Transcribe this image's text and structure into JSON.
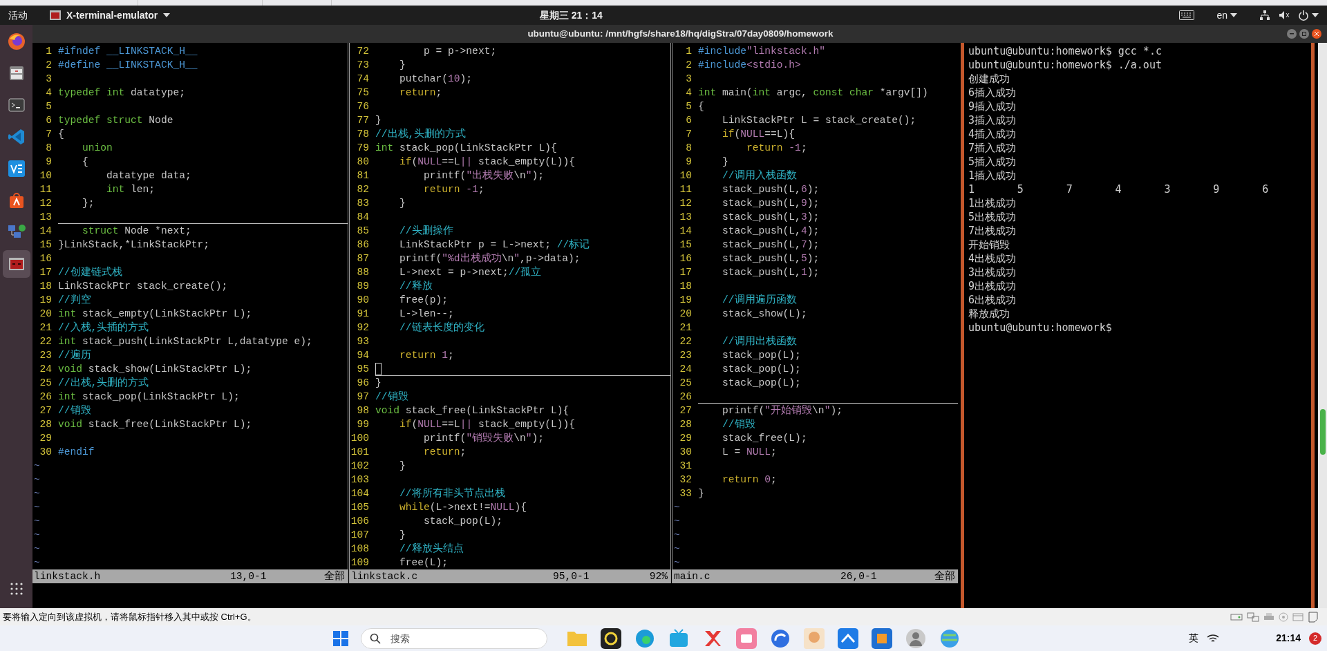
{
  "top_bar": {
    "activities": "活动",
    "app_menu": "X-terminal-emulator",
    "clock": "星期三 21：14",
    "language": "en"
  },
  "window": {
    "title": "ubuntu@ubuntu: /mnt/hgfs/share18/hq/digStra/07day0809/homework"
  },
  "dock": {
    "items": [
      {
        "kind": "browser",
        "active": false
      },
      {
        "kind": "files",
        "active": false
      },
      {
        "kind": "terminal",
        "active": false
      },
      {
        "kind": "code",
        "active": false
      },
      {
        "kind": "vm",
        "active": false
      },
      {
        "kind": "store",
        "active": false
      },
      {
        "kind": "network",
        "active": false
      },
      {
        "kind": "xterm",
        "active": true
      },
      {
        "kind": "apps",
        "active": false
      }
    ]
  },
  "editor_panes": [
    {
      "active": false,
      "lines": [
        {
          "n": "1",
          "current": false,
          "spans": [
            {
              "kind": "pre",
              "text": "#ifndef __LINKSTACK_H__"
            }
          ]
        },
        {
          "n": "2",
          "current": false,
          "spans": [
            {
              "kind": "pre",
              "text": "#define __LINKSTACK_H__"
            }
          ]
        },
        {
          "n": "3",
          "current": false
        },
        {
          "n": "4",
          "current": false,
          "spans": [
            {
              "kind": "type",
              "text": "typedef int"
            },
            {
              "kind": "plain",
              "text": " datatype;"
            }
          ]
        },
        {
          "n": "5",
          "current": false
        },
        {
          "n": "6",
          "current": false,
          "spans": [
            {
              "kind": "type",
              "text": "typedef struct"
            },
            {
              "kind": "plain",
              "text": " Node"
            }
          ]
        },
        {
          "n": "7",
          "current": false,
          "spans": [
            {
              "kind": "plain",
              "text": "{"
            }
          ]
        },
        {
          "n": "8",
          "current": false,
          "spans": [
            {
              "kind": "type",
              "text": "    union"
            }
          ]
        },
        {
          "n": "9",
          "current": false,
          "spans": [
            {
              "kind": "plain",
              "text": "    {"
            }
          ]
        },
        {
          "n": "10",
          "current": false,
          "spans": [
            {
              "kind": "plain",
              "text": "        datatype data;"
            }
          ]
        },
        {
          "n": "11",
          "current": false,
          "spans": [
            {
              "kind": "type",
              "text": "        int"
            },
            {
              "kind": "plain",
              "text": " len;"
            }
          ]
        },
        {
          "n": "12",
          "current": false,
          "spans": [
            {
              "kind": "plain",
              "text": "    };"
            }
          ]
        },
        {
          "n": "13",
          "current": true
        },
        {
          "n": "14",
          "current": false,
          "spans": [
            {
              "kind": "type",
              "text": "    struct"
            },
            {
              "kind": "plain",
              "text": " Node *next;"
            }
          ]
        },
        {
          "n": "15",
          "current": false,
          "spans": [
            {
              "kind": "plain",
              "text": "}LinkStack,*LinkStackPtr;"
            }
          ]
        },
        {
          "n": "16",
          "current": false
        },
        {
          "n": "17",
          "current": false,
          "spans": [
            {
              "kind": "cm",
              "text": "//创建链式栈"
            }
          ]
        },
        {
          "n": "18",
          "current": false,
          "spans": [
            {
              "kind": "plain",
              "text": "LinkStackPtr stack_create();"
            }
          ]
        },
        {
          "n": "19",
          "current": false,
          "spans": [
            {
              "kind": "cm",
              "text": "//判空"
            }
          ]
        },
        {
          "n": "20",
          "current": false,
          "spans": [
            {
              "kind": "type",
              "text": "int"
            },
            {
              "kind": "plain",
              "text": " stack_empty(LinkStackPtr L);"
            }
          ]
        },
        {
          "n": "21",
          "current": false,
          "spans": [
            {
              "kind": "cm",
              "text": "//入栈,头插的方式"
            }
          ]
        },
        {
          "n": "22",
          "current": false,
          "spans": [
            {
              "kind": "type",
              "text": "int"
            },
            {
              "kind": "plain",
              "text": " stack_push(LinkStackPtr L,datatype e);"
            }
          ]
        },
        {
          "n": "23",
          "current": false,
          "spans": [
            {
              "kind": "cm",
              "text": "//遍历"
            }
          ]
        },
        {
          "n": "24",
          "current": false,
          "spans": [
            {
              "kind": "type",
              "text": "void"
            },
            {
              "kind": "plain",
              "text": " stack_show(LinkStackPtr L);"
            }
          ]
        },
        {
          "n": "25",
          "current": false,
          "spans": [
            {
              "kind": "cm",
              "text": "//出栈,头删的方式"
            }
          ]
        },
        {
          "n": "26",
          "current": false,
          "spans": [
            {
              "kind": "type",
              "text": "int"
            },
            {
              "kind": "plain",
              "text": " stack_pop(LinkStackPtr L);"
            }
          ]
        },
        {
          "n": "27",
          "current": false,
          "spans": [
            {
              "kind": "cm",
              "text": "//销毁"
            }
          ]
        },
        {
          "n": "28",
          "current": false,
          "spans": [
            {
              "kind": "type",
              "text": "void"
            },
            {
              "kind": "plain",
              "text": " stack_free(LinkStackPtr L);"
            }
          ]
        },
        {
          "n": "29",
          "current": false
        },
        {
          "n": "30",
          "current": false,
          "spans": [
            {
              "kind": "pre",
              "text": "#endif"
            }
          ]
        }
      ],
      "filler": [
        "~",
        "~",
        "~",
        "~",
        "~",
        "~",
        "~",
        "~"
      ],
      "status": {
        "file": "linkstack.h",
        "position": "13,0-1",
        "scroll": "全部"
      }
    },
    {
      "active": true,
      "lines": [
        {
          "n": "72",
          "current": false,
          "spans": [
            {
              "kind": "plain",
              "text": "        p = p->next;"
            }
          ]
        },
        {
          "n": "73",
          "current": false,
          "spans": [
            {
              "kind": "plain",
              "text": "    }"
            }
          ]
        },
        {
          "n": "74",
          "current": false,
          "spans": [
            {
              "kind": "plain",
              "text": "    putchar("
            },
            {
              "kind": "num",
              "text": "10"
            },
            {
              "kind": "plain",
              "text": ");"
            }
          ]
        },
        {
          "n": "75",
          "current": false,
          "spans": [
            {
              "kind": "kw",
              "text": "    return"
            },
            {
              "kind": "plain",
              "text": ";"
            }
          ]
        },
        {
          "n": "76",
          "current": false
        },
        {
          "n": "77",
          "current": false,
          "spans": [
            {
              "kind": "plain",
              "text": "}"
            }
          ]
        },
        {
          "n": "78",
          "current": false,
          "spans": [
            {
              "kind": "cm",
              "text": "//出栈,头删的方式"
            }
          ]
        },
        {
          "n": "79",
          "current": false,
          "spans": [
            {
              "kind": "type",
              "text": "int"
            },
            {
              "kind": "plain",
              "text": " stack_pop(LinkStackPtr L){"
            }
          ]
        },
        {
          "n": "80",
          "current": false,
          "spans": [
            {
              "kind": "kw",
              "text": "    if"
            },
            {
              "kind": "plain",
              "text": "("
            },
            {
              "kind": "num",
              "text": "NULL"
            },
            {
              "kind": "plain",
              "text": "==L"
            },
            {
              "kind": "num",
              "text": "||"
            },
            {
              "kind": "plain",
              "text": " stack_empty(L)){"
            }
          ]
        },
        {
          "n": "81",
          "current": false,
          "spans": [
            {
              "kind": "plain",
              "text": "        printf("
            },
            {
              "kind": "str",
              "text": "\"出栈失败"
            },
            {
              "kind": "plain",
              "text": "\\n"
            },
            {
              "kind": "str",
              "text": "\""
            },
            {
              "kind": "plain",
              "text": ");"
            }
          ]
        },
        {
          "n": "82",
          "current": false,
          "spans": [
            {
              "kind": "kw",
              "text": "        return"
            },
            {
              "kind": "num",
              "text": " -1"
            },
            {
              "kind": "plain",
              "text": ";"
            }
          ]
        },
        {
          "n": "83",
          "current": false,
          "spans": [
            {
              "kind": "plain",
              "text": "    }"
            }
          ]
        },
        {
          "n": "84",
          "current": false
        },
        {
          "n": "85",
          "current": false,
          "spans": [
            {
              "kind": "cm",
              "text": "    //头删操作"
            }
          ]
        },
        {
          "n": "86",
          "current": false,
          "spans": [
            {
              "kind": "plain",
              "text": "    LinkStackPtr p = L->next; "
            },
            {
              "kind": "cm",
              "text": "//标记"
            }
          ]
        },
        {
          "n": "87",
          "current": false,
          "spans": [
            {
              "kind": "plain",
              "text": "    printf("
            },
            {
              "kind": "str",
              "text": "\"%d出栈成功"
            },
            {
              "kind": "plain",
              "text": "\\n"
            },
            {
              "kind": "str",
              "text": "\""
            },
            {
              "kind": "plain",
              "text": ",p->data);"
            }
          ]
        },
        {
          "n": "88",
          "current": false,
          "spans": [
            {
              "kind": "plain",
              "text": "    L->next = p->next;"
            },
            {
              "kind": "cm",
              "text": "//孤立"
            }
          ]
        },
        {
          "n": "89",
          "current": false,
          "spans": [
            {
              "kind": "cm",
              "text": "    //释放"
            }
          ]
        },
        {
          "n": "90",
          "current": false,
          "spans": [
            {
              "kind": "plain",
              "text": "    free(p);"
            }
          ]
        },
        {
          "n": "91",
          "current": false,
          "spans": [
            {
              "kind": "plain",
              "text": "    L->len--;"
            }
          ]
        },
        {
          "n": "92",
          "current": false,
          "spans": [
            {
              "kind": "cm",
              "text": "    //链表长度的变化"
            }
          ]
        },
        {
          "n": "93",
          "current": false
        },
        {
          "n": "94",
          "current": false,
          "spans": [
            {
              "kind": "kw",
              "text": "    return"
            },
            {
              "kind": "num",
              "text": " 1"
            },
            {
              "kind": "plain",
              "text": ";"
            }
          ]
        },
        {
          "n": "95",
          "current": true
        },
        {
          "n": "96",
          "current": false,
          "spans": [
            {
              "kind": "plain",
              "text": "}"
            }
          ]
        },
        {
          "n": "97",
          "current": false,
          "spans": [
            {
              "kind": "cm",
              "text": "//销毁"
            }
          ]
        },
        {
          "n": "98",
          "current": false,
          "spans": [
            {
              "kind": "type",
              "text": "void"
            },
            {
              "kind": "plain",
              "text": " stack_free(LinkStackPtr L){"
            }
          ]
        },
        {
          "n": "99",
          "current": false,
          "spans": [
            {
              "kind": "kw",
              "text": "    if"
            },
            {
              "kind": "plain",
              "text": "("
            },
            {
              "kind": "num",
              "text": "NULL"
            },
            {
              "kind": "plain",
              "text": "==L"
            },
            {
              "kind": "num",
              "text": "||"
            },
            {
              "kind": "plain",
              "text": " stack_empty(L)){"
            }
          ]
        },
        {
          "n": "100",
          "current": false,
          "spans": [
            {
              "kind": "plain",
              "text": "        printf("
            },
            {
              "kind": "str",
              "text": "\"销毁失败"
            },
            {
              "kind": "plain",
              "text": "\\n"
            },
            {
              "kind": "str",
              "text": "\""
            },
            {
              "kind": "plain",
              "text": ");"
            }
          ]
        },
        {
          "n": "101",
          "current": false,
          "spans": [
            {
              "kind": "kw",
              "text": "        return"
            },
            {
              "kind": "plain",
              "text": ";"
            }
          ]
        },
        {
          "n": "102",
          "current": false,
          "spans": [
            {
              "kind": "plain",
              "text": "    }"
            }
          ]
        },
        {
          "n": "103",
          "current": false
        },
        {
          "n": "104",
          "current": false,
          "spans": [
            {
              "kind": "cm",
              "text": "    //将所有非头节点出栈"
            }
          ]
        },
        {
          "n": "105",
          "current": false,
          "spans": [
            {
              "kind": "kw",
              "text": "    while"
            },
            {
              "kind": "plain",
              "text": "(L->next!="
            },
            {
              "kind": "num",
              "text": "NULL"
            },
            {
              "kind": "plain",
              "text": "){"
            }
          ]
        },
        {
          "n": "106",
          "current": false,
          "spans": [
            {
              "kind": "plain",
              "text": "        stack_pop(L);"
            }
          ]
        },
        {
          "n": "107",
          "current": false,
          "spans": [
            {
              "kind": "plain",
              "text": "    }"
            }
          ]
        },
        {
          "n": "108",
          "current": false,
          "spans": [
            {
              "kind": "cm",
              "text": "    //释放头结点"
            }
          ]
        },
        {
          "n": "109",
          "current": false,
          "spans": [
            {
              "kind": "plain",
              "text": "    free(L);"
            }
          ]
        }
      ],
      "status": {
        "file": "linkstack.c",
        "position": "95,0-1",
        "scroll": "92%"
      }
    },
    {
      "active": false,
      "lines": [
        {
          "n": "1",
          "current": false,
          "spans": [
            {
              "kind": "pre",
              "text": "#include"
            },
            {
              "kind": "str",
              "text": "\"linkstack.h\""
            }
          ]
        },
        {
          "n": "2",
          "current": false,
          "spans": [
            {
              "kind": "pre",
              "text": "#include"
            },
            {
              "kind": "str",
              "text": "<stdio.h>"
            }
          ]
        },
        {
          "n": "3",
          "current": false
        },
        {
          "n": "4",
          "current": false,
          "spans": [
            {
              "kind": "type",
              "text": "int"
            },
            {
              "kind": "plain",
              "text": " main("
            },
            {
              "kind": "type",
              "text": "int"
            },
            {
              "kind": "plain",
              "text": " argc, "
            },
            {
              "kind": "type",
              "text": "const char"
            },
            {
              "kind": "plain",
              "text": " *argv[])"
            }
          ]
        },
        {
          "n": "5",
          "current": false,
          "spans": [
            {
              "kind": "plain",
              "text": "{"
            }
          ]
        },
        {
          "n": "6",
          "current": false,
          "spans": [
            {
              "kind": "plain",
              "text": "    LinkStackPtr L = stack_create();"
            }
          ]
        },
        {
          "n": "7",
          "current": false,
          "spans": [
            {
              "kind": "kw",
              "text": "    if"
            },
            {
              "kind": "plain",
              "text": "("
            },
            {
              "kind": "num",
              "text": "NULL"
            },
            {
              "kind": "plain",
              "text": "==L){"
            }
          ]
        },
        {
          "n": "8",
          "current": false,
          "spans": [
            {
              "kind": "kw",
              "text": "        return"
            },
            {
              "kind": "num",
              "text": " -1"
            },
            {
              "kind": "plain",
              "text": ";"
            }
          ]
        },
        {
          "n": "9",
          "current": false,
          "spans": [
            {
              "kind": "plain",
              "text": "    }"
            }
          ]
        },
        {
          "n": "10",
          "current": false,
          "spans": [
            {
              "kind": "cm",
              "text": "    //调用入栈函数"
            }
          ]
        },
        {
          "n": "11",
          "current": false,
          "spans": [
            {
              "kind": "plain",
              "text": "    stack_push(L,"
            },
            {
              "kind": "num",
              "text": "6"
            },
            {
              "kind": "plain",
              "text": ");"
            }
          ]
        },
        {
          "n": "12",
          "current": false,
          "spans": [
            {
              "kind": "plain",
              "text": "    stack_push(L,"
            },
            {
              "kind": "num",
              "text": "9"
            },
            {
              "kind": "plain",
              "text": ");"
            }
          ]
        },
        {
          "n": "13",
          "current": false,
          "spans": [
            {
              "kind": "plain",
              "text": "    stack_push(L,"
            },
            {
              "kind": "num",
              "text": "3"
            },
            {
              "kind": "plain",
              "text": ");"
            }
          ]
        },
        {
          "n": "14",
          "current": false,
          "spans": [
            {
              "kind": "plain",
              "text": "    stack_push(L,"
            },
            {
              "kind": "num",
              "text": "4"
            },
            {
              "kind": "plain",
              "text": ");"
            }
          ]
        },
        {
          "n": "15",
          "current": false,
          "spans": [
            {
              "kind": "plain",
              "text": "    stack_push(L,"
            },
            {
              "kind": "num",
              "text": "7"
            },
            {
              "kind": "plain",
              "text": ");"
            }
          ]
        },
        {
          "n": "16",
          "current": false,
          "spans": [
            {
              "kind": "plain",
              "text": "    stack_push(L,"
            },
            {
              "kind": "num",
              "text": "5"
            },
            {
              "kind": "plain",
              "text": ");"
            }
          ]
        },
        {
          "n": "17",
          "current": false,
          "spans": [
            {
              "kind": "plain",
              "text": "    stack_push(L,"
            },
            {
              "kind": "num",
              "text": "1"
            },
            {
              "kind": "plain",
              "text": ");"
            }
          ]
        },
        {
          "n": "18",
          "current": false
        },
        {
          "n": "19",
          "current": false,
          "spans": [
            {
              "kind": "cm",
              "text": "    //调用遍历函数"
            }
          ]
        },
        {
          "n": "20",
          "current": false,
          "spans": [
            {
              "kind": "plain",
              "text": "    stack_show(L);"
            }
          ]
        },
        {
          "n": "21",
          "current": false
        },
        {
          "n": "22",
          "current": false,
          "spans": [
            {
              "kind": "cm",
              "text": "    //调用出栈函数"
            }
          ]
        },
        {
          "n": "23",
          "current": false,
          "spans": [
            {
              "kind": "plain",
              "text": "    stack_pop(L);"
            }
          ]
        },
        {
          "n": "24",
          "current": false,
          "spans": [
            {
              "kind": "plain",
              "text": "    stack_pop(L);"
            }
          ]
        },
        {
          "n": "25",
          "current": false,
          "spans": [
            {
              "kind": "plain",
              "text": "    stack_pop(L);"
            }
          ]
        },
        {
          "n": "26",
          "current": true
        },
        {
          "n": "27",
          "current": false,
          "spans": [
            {
              "kind": "plain",
              "text": "    printf("
            },
            {
              "kind": "str",
              "text": "\"开始销毁"
            },
            {
              "kind": "plain",
              "text": "\\n"
            },
            {
              "kind": "str",
              "text": "\""
            },
            {
              "kind": "plain",
              "text": ");"
            }
          ]
        },
        {
          "n": "28",
          "current": false,
          "spans": [
            {
              "kind": "cm",
              "text": "    //销毁"
            }
          ]
        },
        {
          "n": "29",
          "current": false,
          "spans": [
            {
              "kind": "plain",
              "text": "    stack_free(L);"
            }
          ]
        },
        {
          "n": "30",
          "current": false,
          "spans": [
            {
              "kind": "plain",
              "text": "    L = "
            },
            {
              "kind": "num",
              "text": "NULL"
            },
            {
              "kind": "plain",
              "text": ";"
            }
          ]
        },
        {
          "n": "31",
          "current": false
        },
        {
          "n": "32",
          "current": false,
          "spans": [
            {
              "kind": "kw",
              "text": "    return"
            },
            {
              "kind": "num",
              "text": " 0"
            },
            {
              "kind": "plain",
              "text": ";"
            }
          ]
        },
        {
          "n": "33",
          "current": false,
          "spans": [
            {
              "kind": "plain",
              "text": "}"
            }
          ]
        }
      ],
      "filler": [
        "~",
        "~",
        "~",
        "~",
        "~"
      ],
      "status": {
        "file": "main.c",
        "position": "26,0-1",
        "scroll": "全部"
      }
    }
  ],
  "terminal": {
    "lines": [
      {
        "kind": "text",
        "text": "ubuntu@ubuntu:homework$ gcc *.c"
      },
      {
        "kind": "text",
        "text": "ubuntu@ubuntu:homework$ ./a.out"
      },
      {
        "kind": "text",
        "text": "创建成功"
      },
      {
        "kind": "text",
        "text": "6插入成功"
      },
      {
        "kind": "text",
        "text": "9插入成功"
      },
      {
        "kind": "text",
        "text": "3插入成功"
      },
      {
        "kind": "text",
        "text": "4插入成功"
      },
      {
        "kind": "text",
        "text": "7插入成功"
      },
      {
        "kind": "text",
        "text": "5插入成功"
      },
      {
        "kind": "text",
        "text": "1插入成功"
      },
      {
        "kind": "columns",
        "values": [
          "1",
          "5",
          "7",
          "4",
          "3",
          "9",
          "6"
        ]
      },
      {
        "kind": "text",
        "text": "1出栈成功"
      },
      {
        "kind": "text",
        "text": "5出栈成功"
      },
      {
        "kind": "text",
        "text": "7出栈成功"
      },
      {
        "kind": "text",
        "text": "开始销毁"
      },
      {
        "kind": "text",
        "text": "4出栈成功"
      },
      {
        "kind": "text",
        "text": "3出栈成功"
      },
      {
        "kind": "text",
        "text": "9出栈成功"
      },
      {
        "kind": "text",
        "text": "6出栈成功"
      },
      {
        "kind": "text",
        "text": "释放成功"
      },
      {
        "kind": "text",
        "text": "ubuntu@ubuntu:homework$"
      }
    ]
  },
  "vm_status": {
    "message": "要将输入定向到该虚拟机，请将鼠标指针移入其中或按 Ctrl+G。"
  },
  "taskbar": {
    "search_placeholder": "搜索",
    "ime": "英",
    "time": "21:14",
    "badge": "2"
  }
}
